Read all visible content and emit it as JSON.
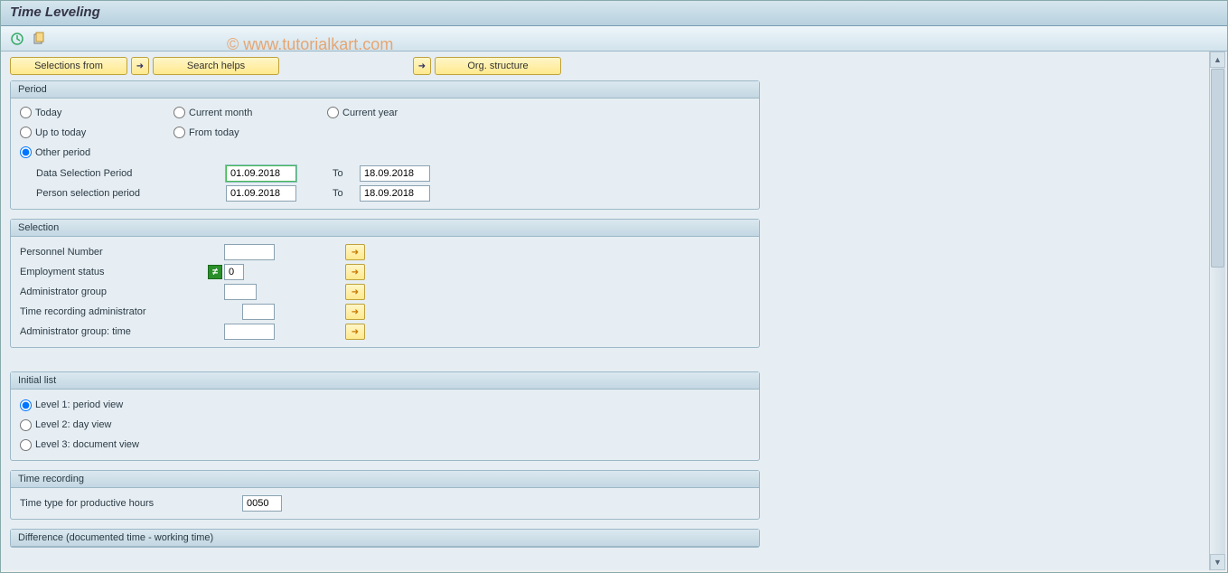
{
  "title": "Time Leveling",
  "watermark": "© www.tutorialkart.com",
  "topButtons": {
    "selectionsFrom": "Selections from",
    "searchHelps": "Search helps",
    "orgStructure": "Org. structure"
  },
  "period": {
    "title": "Period",
    "today": "Today",
    "currentMonth": "Current month",
    "currentYear": "Current year",
    "upToToday": "Up to today",
    "fromToday": "From today",
    "otherPeriod": "Other period",
    "dataSelLabel": "Data Selection Period",
    "personSelLabel": "Person selection period",
    "to": "To",
    "dataFrom": "01.09.2018",
    "dataTo": "18.09.2018",
    "personFrom": "01.09.2018",
    "personTo": "18.09.2018"
  },
  "selection": {
    "title": "Selection",
    "personnelNumber": "Personnel Number",
    "employmentStatus": "Employment status",
    "employmentStatusValue": "0",
    "adminGroup": "Administrator group",
    "timeRecAdmin": "Time recording administrator",
    "adminGroupTime": "Administrator group: time"
  },
  "initialList": {
    "title": "Initial list",
    "level1": "Level 1: period view",
    "level2": "Level 2: day view",
    "level3": "Level 3: document view"
  },
  "timeRecording": {
    "title": "Time recording",
    "timeTypeLabel": "Time type for productive hours",
    "timeTypeValue": "0050"
  },
  "difference": {
    "title": "Difference (documented time - working time)"
  }
}
